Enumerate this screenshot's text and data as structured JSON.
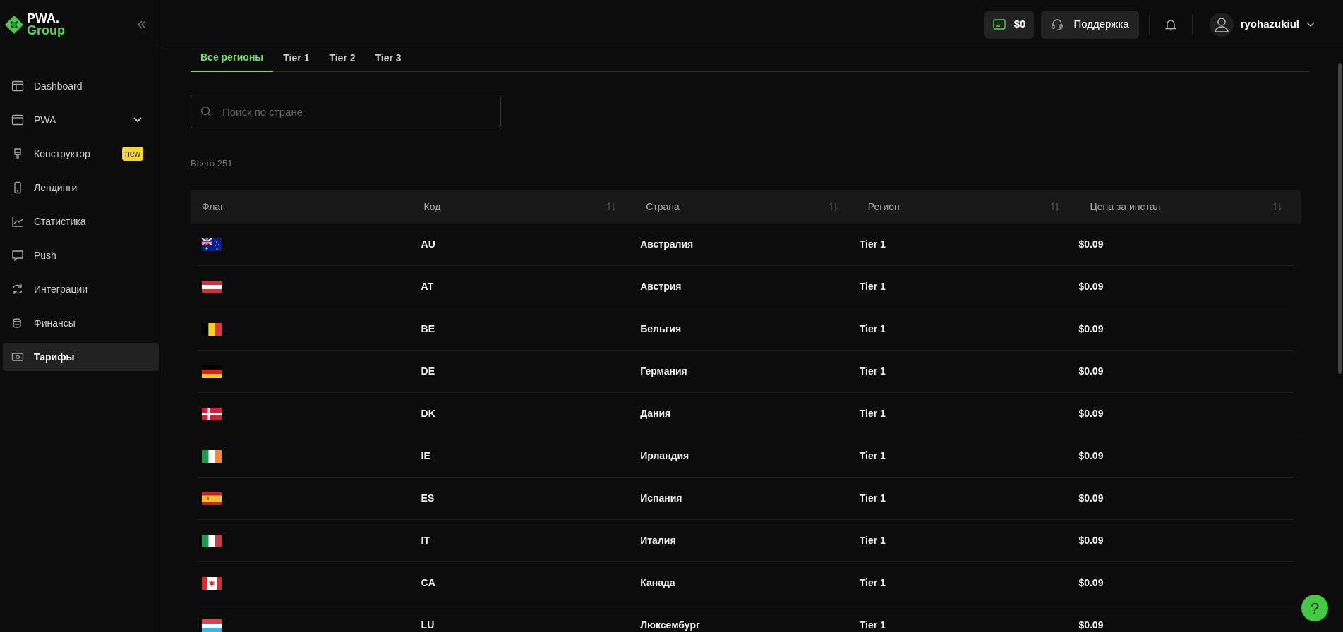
{
  "logo": {
    "line_1": "PWA.",
    "line_2": "Group"
  },
  "sidebar": {
    "items": [
      {
        "kind": "dashboard",
        "label": "Dashboard",
        "selected": false
      },
      {
        "kind": "pwa",
        "label": "PWA",
        "selected": false,
        "expanded": false
      },
      {
        "kind": "builder",
        "label": "Конструктор",
        "selected": false,
        "badge": "new"
      },
      {
        "kind": "landings",
        "label": "Лендинги",
        "selected": false
      },
      {
        "kind": "stats",
        "label": "Статистика",
        "selected": false
      },
      {
        "kind": "push",
        "label": "Push",
        "selected": false
      },
      {
        "kind": "integrations",
        "label": "Интеграции",
        "selected": false
      },
      {
        "kind": "finance",
        "label": "Финансы",
        "selected": false
      },
      {
        "kind": "tariffs",
        "label": "Тарифы",
        "selected": true
      }
    ]
  },
  "topbar": {
    "balance": "$0",
    "support": "Поддержка",
    "username": "ryohazukiul"
  },
  "tabs": [
    {
      "label": "Все регионы",
      "selected": true
    },
    {
      "label": "Tier 1",
      "selected": false
    },
    {
      "label": "Tier 2",
      "selected": false
    },
    {
      "label": "Tier 3",
      "selected": false
    }
  ],
  "search": {
    "placeholder": "Поиск по стране"
  },
  "total": "Всего 251",
  "table": {
    "columns": [
      {
        "label": "Флаг",
        "sortable": false
      },
      {
        "label": "Код",
        "sortable": true
      },
      {
        "label": "Страна",
        "sortable": true
      },
      {
        "label": "Регион",
        "sortable": true
      },
      {
        "label": "Цена за инстал",
        "sortable": true
      }
    ],
    "rows": [
      {
        "kind": "au",
        "code": "AU",
        "country": "Австралия",
        "region": "Tier 1",
        "price": "$0.09"
      },
      {
        "kind": "at",
        "code": "AT",
        "country": "Австрия",
        "region": "Tier 1",
        "price": "$0.09"
      },
      {
        "kind": "be",
        "code": "BE",
        "country": "Бельгия",
        "region": "Tier 1",
        "price": "$0.09"
      },
      {
        "kind": "de",
        "code": "DE",
        "country": "Германия",
        "region": "Tier 1",
        "price": "$0.09"
      },
      {
        "kind": "dk",
        "code": "DK",
        "country": "Дания",
        "region": "Tier 1",
        "price": "$0.09"
      },
      {
        "kind": "ie",
        "code": "IE",
        "country": "Ирландия",
        "region": "Tier 1",
        "price": "$0.09"
      },
      {
        "kind": "es",
        "code": "ES",
        "country": "Испания",
        "region": "Tier 1",
        "price": "$0.09"
      },
      {
        "kind": "it",
        "code": "IT",
        "country": "Италия",
        "region": "Tier 1",
        "price": "$0.09"
      },
      {
        "kind": "ca",
        "code": "CA",
        "country": "Канада",
        "region": "Tier 1",
        "price": "$0.09"
      },
      {
        "kind": "lu",
        "code": "LU",
        "country": "Люксембург",
        "region": "Tier 1",
        "price": "$0.09"
      }
    ]
  },
  "help": {
    "label": "?"
  }
}
